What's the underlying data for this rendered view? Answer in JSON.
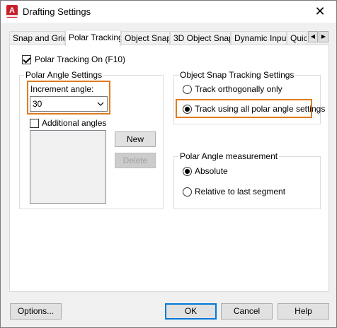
{
  "window": {
    "title": "Drafting Settings",
    "app_icon_letter": "A"
  },
  "tabs": [
    {
      "label": "Snap and Grid"
    },
    {
      "label": "Polar Tracking"
    },
    {
      "label": "Object Snap"
    },
    {
      "label": "3D Object Snap"
    },
    {
      "label": "Dynamic Input"
    },
    {
      "label": "Quic"
    }
  ],
  "polar_tracking_on": {
    "label": "Polar Tracking On (F10)",
    "checked": true
  },
  "polar_angle_settings": {
    "title": "Polar Angle Settings",
    "increment_label": "Increment angle:",
    "increment_value": "30",
    "additional_angles_label": "Additional angles",
    "new_label": "New",
    "delete_label": "Delete"
  },
  "object_snap_tracking": {
    "title": "Object Snap Tracking Settings",
    "options": [
      {
        "label": "Track orthogonally only",
        "checked": false
      },
      {
        "label": "Track using all polar angle settings",
        "checked": true
      }
    ]
  },
  "polar_angle_measurement": {
    "title": "Polar Angle measurement",
    "options": [
      {
        "label": "Absolute",
        "checked": true
      },
      {
        "label": "Relative to last segment",
        "checked": false
      }
    ]
  },
  "footer": {
    "options_label": "Options...",
    "ok_label": "OK",
    "cancel_label": "Cancel",
    "help_label": "Help"
  },
  "colors": {
    "highlight": "#e07b20",
    "accent": "#0078d7",
    "app_icon": "#c8202a"
  }
}
